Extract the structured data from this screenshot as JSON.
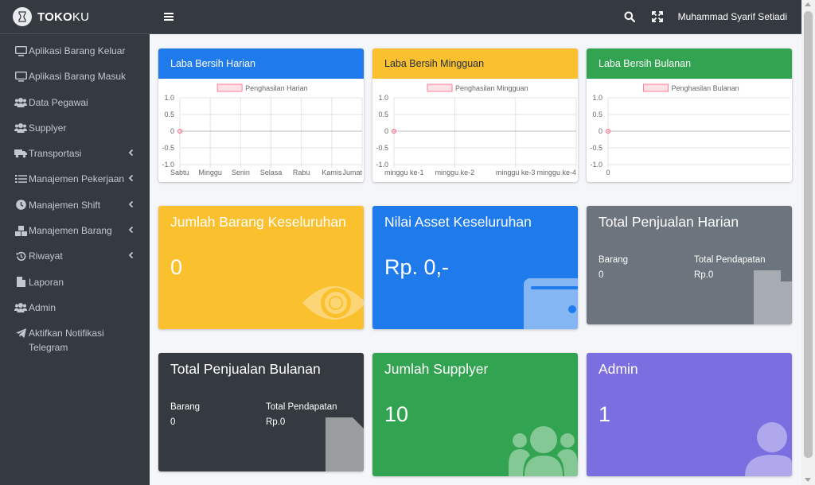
{
  "brand": {
    "bold": "TOKO",
    "light": "KU"
  },
  "sidebar": {
    "items": [
      {
        "label": "Aplikasi Barang Keluar",
        "icon": "monitor-icon",
        "chevron": false
      },
      {
        "label": "Aplikasi Barang Masuk",
        "icon": "monitor-icon",
        "chevron": false
      },
      {
        "label": "Data Pegawai",
        "icon": "users-icon",
        "chevron": false
      },
      {
        "label": "Supplyer",
        "icon": "users-icon",
        "chevron": false
      },
      {
        "label": "Transportasi",
        "icon": "truck-icon",
        "chevron": true
      },
      {
        "label": "Manajemen Pekerjaan",
        "icon": "tasks-icon",
        "chevron": true
      },
      {
        "label": "Manajemen Shift",
        "icon": "clock-icon",
        "chevron": true
      },
      {
        "label": "Manajemen Barang",
        "icon": "boxes-icon",
        "chevron": true
      },
      {
        "label": "Riwayat",
        "icon": "history-icon",
        "chevron": true
      },
      {
        "label": "Laporan",
        "icon": "file-icon",
        "chevron": false
      },
      {
        "label": "Admin",
        "icon": "users-icon",
        "chevron": false
      },
      {
        "label": "Aktifkan Notifikasi Telegram",
        "icon": "telegram-icon",
        "chevron": false
      }
    ]
  },
  "topbar": {
    "user": "Muhammad Syarif Setiadi"
  },
  "charts": [
    {
      "title": "Laba Bersih Harian",
      "header_color": "#1f7bec",
      "header_text_color": "#ffffff",
      "legend": "Penghasilan Harian",
      "y_ticks": [
        "1.0",
        "0.5",
        "0",
        "-0.5",
        "-1.0"
      ],
      "x_labels": [
        "Sabtu",
        "Minggu",
        "Senin",
        "Selasa",
        "Rabu",
        "Kamis",
        "Jumat"
      ]
    },
    {
      "title": "Laba Bersih Mingguan",
      "header_color": "#fbc02d",
      "header_text_color": "#1f2d3d",
      "legend": "Penghasilan Mingguan",
      "y_ticks": [
        "1.0",
        "0.5",
        "0",
        "-0.5",
        "-1.0"
      ],
      "x_labels": [
        "minggu ke-1",
        "minggu ke-2",
        "minggu ke-3",
        "minggu ke-4"
      ]
    },
    {
      "title": "Laba Bersih Bulanan",
      "header_color": "#32a350",
      "header_text_color": "#ffffff",
      "legend": "Penghasilan Bulanan",
      "y_ticks": [
        "1.0",
        "0.5",
        "0",
        "-0.5",
        "-1.0"
      ],
      "x_labels": [
        "0"
      ]
    }
  ],
  "chart_data": [
    {
      "type": "line",
      "title": "Laba Bersih Harian",
      "categories": [
        "Sabtu",
        "Minggu",
        "Senin",
        "Selasa",
        "Rabu",
        "Kamis",
        "Jumat"
      ],
      "series": [
        {
          "name": "Penghasilan Harian",
          "values": [
            0
          ]
        }
      ],
      "ylim": [
        -1.0,
        1.0
      ],
      "grid": true,
      "legend": "top"
    },
    {
      "type": "line",
      "title": "Laba Bersih Mingguan",
      "categories": [
        "minggu ke-1",
        "minggu ke-2",
        "minggu ke-3",
        "minggu ke-4"
      ],
      "series": [
        {
          "name": "Penghasilan Mingguan",
          "values": [
            0
          ]
        }
      ],
      "ylim": [
        -1.0,
        1.0
      ],
      "grid": true,
      "legend": "top"
    },
    {
      "type": "line",
      "title": "Laba Bersih Bulanan",
      "categories": [
        "0"
      ],
      "series": [
        {
          "name": "Penghasilan Bulanan",
          "values": [
            0
          ]
        }
      ],
      "ylim": [
        -1.0,
        1.0
      ],
      "grid": true,
      "legend": "top"
    }
  ],
  "boxes": {
    "barang": {
      "title": "Jumlah Barang Keseluruhan",
      "value": "0",
      "color": "#fbc02d"
    },
    "asset": {
      "title": "Nilai Asset Keseluruhan",
      "value": "Rp. 0,-",
      "color": "#1f7bec"
    },
    "harian": {
      "title": "Total Penjualan Harian",
      "barang_label": "Barang",
      "barang_value": "0",
      "pendapatan_label": "Total Pendapatan",
      "pendapatan_value": "Rp.0",
      "color": "#6c757d"
    },
    "bulanan": {
      "title": "Total Penjualan Bulanan",
      "barang_label": "Barang",
      "barang_value": "0",
      "pendapatan_label": "Total Pendapatan",
      "pendapatan_value": "Rp.0",
      "color": "#343a40"
    },
    "supplyer": {
      "title": "Jumlah Supplyer",
      "value": "10",
      "color": "#32a350"
    },
    "admin": {
      "title": "Admin",
      "value": "1",
      "color": "#7b6ee1"
    }
  },
  "icons": {
    "search": "search-icon",
    "fullscreen": "expand-icon",
    "menu": "bars-icon"
  }
}
